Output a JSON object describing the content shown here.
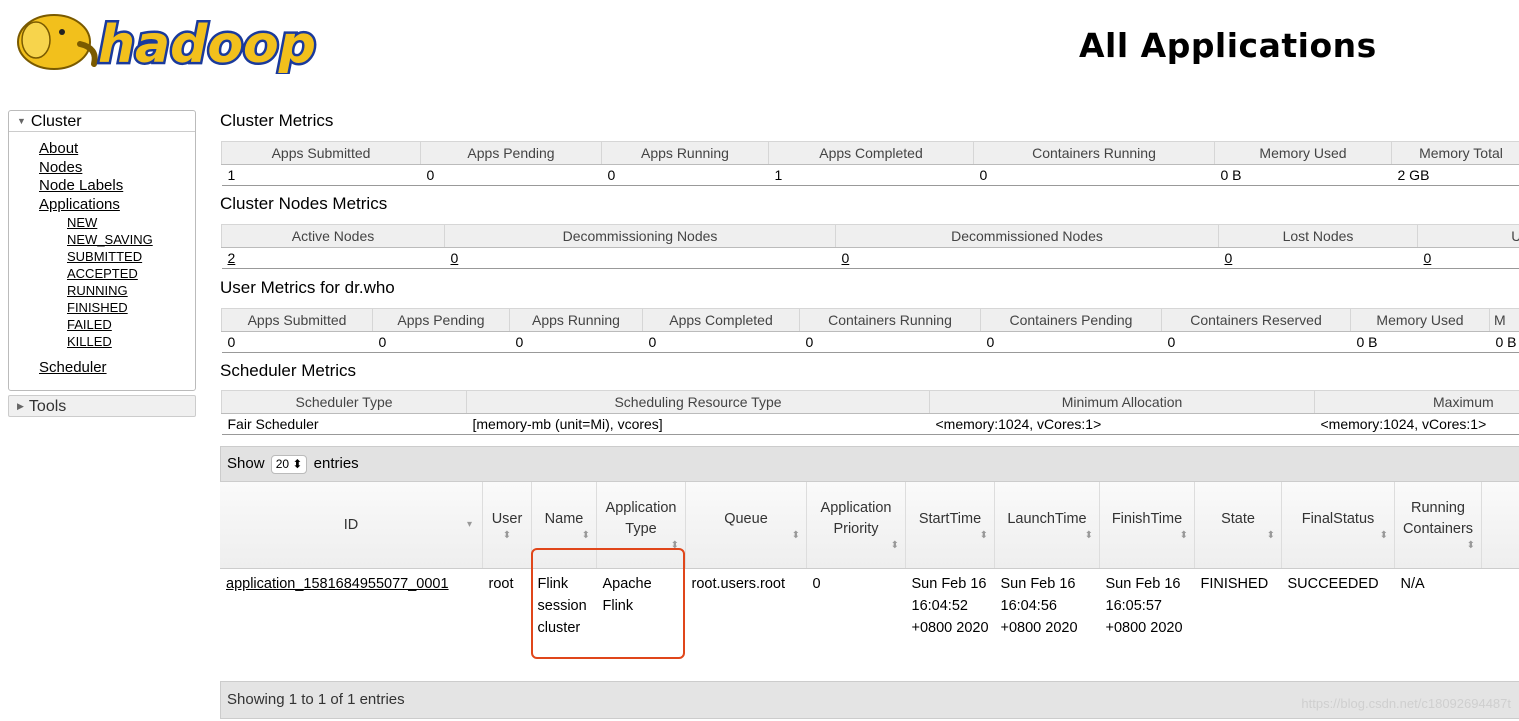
{
  "header": {
    "logo_text": "hadoop",
    "title": "All Applications"
  },
  "sidebar": {
    "cluster_label": "Cluster",
    "links": [
      "About",
      "Nodes",
      "Node Labels",
      "Applications"
    ],
    "app_states": [
      "NEW",
      "NEW_SAVING",
      "SUBMITTED",
      "ACCEPTED",
      "RUNNING",
      "FINISHED",
      "FAILED",
      "KILLED"
    ],
    "scheduler_link": "Scheduler",
    "tools_label": "Tools"
  },
  "cluster_metrics": {
    "title": "Cluster Metrics",
    "headers": [
      "Apps Submitted",
      "Apps Pending",
      "Apps Running",
      "Apps Completed",
      "Containers Running",
      "Memory Used",
      "Memory Total"
    ],
    "values": [
      "1",
      "0",
      "0",
      "1",
      "0",
      "0 B",
      "2 GB"
    ]
  },
  "nodes_metrics": {
    "title": "Cluster Nodes Metrics",
    "headers": [
      "Active Nodes",
      "Decommissioning Nodes",
      "Decommissioned Nodes",
      "Lost Nodes",
      "Ur"
    ],
    "values": [
      "2",
      "0",
      "0",
      "0",
      "0"
    ]
  },
  "user_metrics": {
    "title": "User Metrics for dr.who",
    "headers": [
      "Apps Submitted",
      "Apps Pending",
      "Apps Running",
      "Apps Completed",
      "Containers Running",
      "Containers Pending",
      "Containers Reserved",
      "Memory Used",
      "M"
    ],
    "values": [
      "0",
      "0",
      "0",
      "0",
      "0",
      "0",
      "0",
      "0 B",
      "0 B"
    ]
  },
  "scheduler_metrics": {
    "title": "Scheduler Metrics",
    "headers": [
      "Scheduler Type",
      "Scheduling Resource Type",
      "Minimum Allocation",
      "Maximum"
    ],
    "values": [
      "Fair Scheduler",
      "[memory-mb (unit=Mi), vcores]",
      "<memory:1024, vCores:1>",
      "<memory:1024, vCores:1>"
    ]
  },
  "apps_table": {
    "show_label": "Show",
    "entries_value": "20",
    "entries_label": "entries",
    "columns": [
      "ID",
      "User",
      "Name",
      "Application Type",
      "Queue",
      "Application Priority",
      "StartTime",
      "LaunchTime",
      "FinishTime",
      "State",
      "FinalStatus",
      "Running Containers"
    ],
    "rows": [
      [
        "application_1581684955077_0001",
        "root",
        "Flink session cluster",
        "Apache Flink",
        "root.users.root",
        "0",
        "Sun Feb 16 16:04:52 +0800 2020",
        "Sun Feb 16 16:04:56 +0800 2020",
        "Sun Feb 16 16:05:57 +0800 2020",
        "FINISHED",
        "SUCCEEDED",
        "N/A"
      ]
    ],
    "footer": "Showing 1 to 1 of 1 entries"
  },
  "watermark": "https://blog.csdn.net/c18092694487t",
  "colors": {
    "highlight": "#e0461a",
    "logo_blue": "#1a3a9c",
    "logo_yellow": "#f2c01c"
  }
}
